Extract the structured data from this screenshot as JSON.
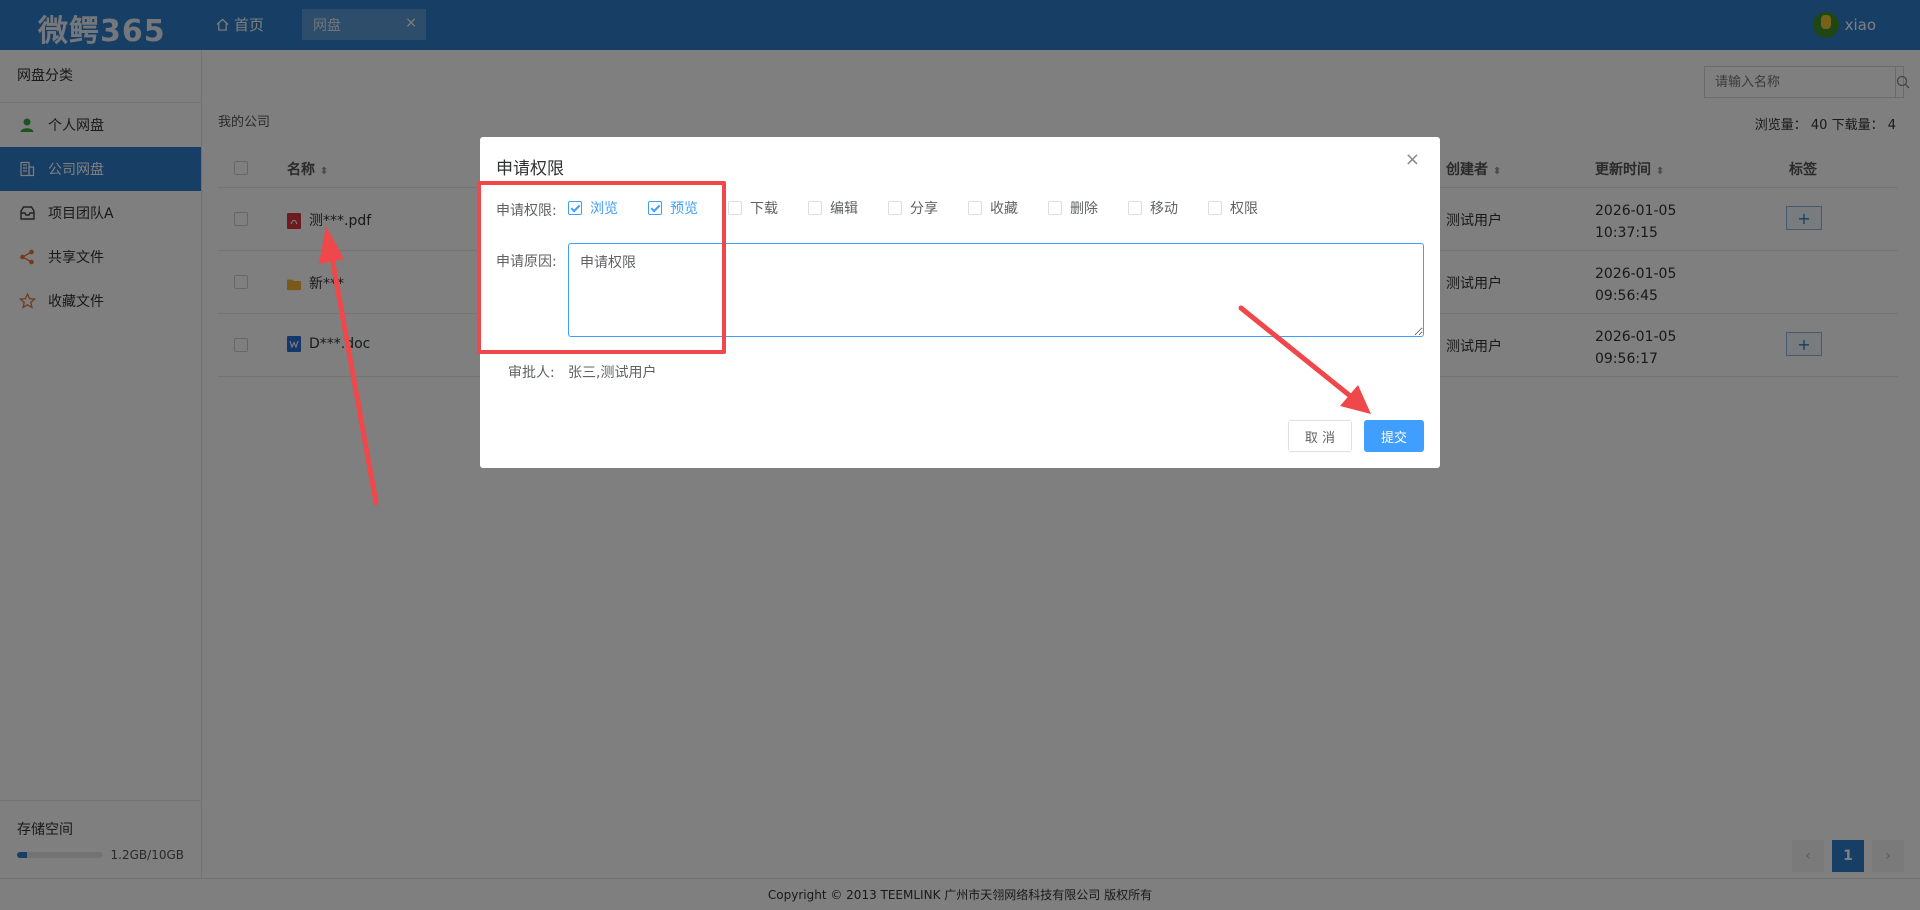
{
  "header": {
    "logo": "微鳄365",
    "home_label": "首页",
    "tab_label": "网盘",
    "tab_close": "×",
    "username": "xiao"
  },
  "sidebar": {
    "title": "网盘分类",
    "items": [
      {
        "label": "个人网盘",
        "icon": "user-icon"
      },
      {
        "label": "公司网盘",
        "icon": "building-icon"
      },
      {
        "label": "项目团队A",
        "icon": "inbox-icon"
      },
      {
        "label": "共享文件",
        "icon": "share-icon"
      },
      {
        "label": "收藏文件",
        "icon": "star-icon"
      }
    ],
    "storage_label": "存储空间",
    "storage_text": "1.2GB/10GB",
    "storage_fraction": 0.12
  },
  "main": {
    "search_placeholder": "请输入名称",
    "breadcrumb": "我的公司",
    "stats": "浏览量：  40   下载量：  4",
    "columns": {
      "name": "名称",
      "creator": "创建者",
      "updated": "更新时间",
      "tags": "标签"
    },
    "rows": [
      {
        "name": "测***.pdf",
        "type": "pdf",
        "creator": "测试用户",
        "date": "2026-01-05",
        "time": "10:37:15",
        "has_tag_button": true
      },
      {
        "name": "新***",
        "type": "folder",
        "creator": "测试用户",
        "date": "2026-01-05",
        "time": "09:56:45",
        "has_tag_button": false
      },
      {
        "name": "D***.doc",
        "type": "doc",
        "creator": "测试用户",
        "date": "2026-01-05",
        "time": "09:56:17",
        "has_tag_button": true
      }
    ],
    "pagination": {
      "prev": "‹",
      "current": "1",
      "next": "›"
    }
  },
  "footer": "Copyright © 2013 TEEMLINK 广州市天翎网络科技有限公司 版权所有",
  "dialog": {
    "title": "申请权限",
    "close": "×",
    "perm_label": "申请权限:",
    "permissions": [
      {
        "label": "浏览",
        "checked": true
      },
      {
        "label": "预览",
        "checked": true
      },
      {
        "label": "下载",
        "checked": false
      },
      {
        "label": "编辑",
        "checked": false
      },
      {
        "label": "分享",
        "checked": false
      },
      {
        "label": "收藏",
        "checked": false
      },
      {
        "label": "删除",
        "checked": false
      },
      {
        "label": "移动",
        "checked": false
      },
      {
        "label": "权限",
        "checked": false
      }
    ],
    "reason_label": "申请原因:",
    "reason_value": "申请权限",
    "approver_label": "审批人:",
    "approver_value": "张三,测试用户",
    "cancel_label": "取 消",
    "submit_label": "提交"
  },
  "colors": {
    "header_bg": "#2f7cc8",
    "accent": "#409eff",
    "annotation": "#f0474a"
  }
}
